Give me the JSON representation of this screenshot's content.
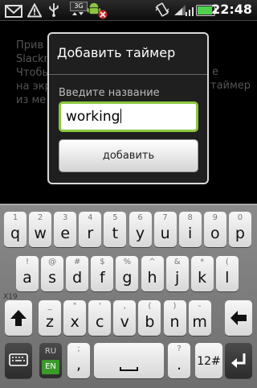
{
  "status_bar": {
    "time": "22:48",
    "network": "3G",
    "battery_level": 1.0,
    "icons": [
      "gmail-icon",
      "alert-icon",
      "usb-icon",
      "signal-3g-icon",
      "android-debug-icon",
      "sd-card-icon",
      "vibrate-icon",
      "wifi-icon",
      "signal-icon",
      "battery-icon"
    ]
  },
  "background": {
    "lines": [
      "Прив",
      "Slackn",
      "Чтобы",
      "на экр",
      "из ме"
    ],
    "right_fragments": [
      "е",
      "таймер"
    ]
  },
  "dialog": {
    "title": "Добавить таймер",
    "input_label": "Введите название",
    "input_value": "working",
    "add_button": "добавить"
  },
  "keyboard": {
    "row1": [
      {
        "sym": "1",
        "ch": "q"
      },
      {
        "sym": "2",
        "ch": "w"
      },
      {
        "sym": "3",
        "ch": "e"
      },
      {
        "sym": "4",
        "ch": "r"
      },
      {
        "sym": "5",
        "ch": "t"
      },
      {
        "sym": "6",
        "ch": "y"
      },
      {
        "sym": "7",
        "ch": "u"
      },
      {
        "sym": "8",
        "ch": "i"
      },
      {
        "sym": "9",
        "ch": "o"
      },
      {
        "sym": "0",
        "ch": "p"
      }
    ],
    "row2": [
      {
        "sym": "!",
        "ch": "a"
      },
      {
        "sym": "@",
        "ch": "s"
      },
      {
        "sym": "#",
        "ch": "d"
      },
      {
        "sym": "$",
        "ch": "f"
      },
      {
        "sym": "%",
        "ch": "g"
      },
      {
        "sym": "^",
        "ch": "h"
      },
      {
        "sym": "&",
        "ch": "j"
      },
      {
        "sym": "*",
        "ch": "k"
      },
      {
        "sym": "(",
        "ch": "l"
      }
    ],
    "row3": [
      {
        "sym": "_",
        "ch": "z"
      },
      {
        "sym": "\"",
        "ch": "x"
      },
      {
        "sym": "'",
        "ch": "c"
      },
      {
        "sym": ",",
        "ch": "v"
      },
      {
        "sym": "(",
        "ch": "b"
      },
      {
        "sym": ")",
        "ch": "n"
      },
      {
        "sym": "-",
        "ch": "m"
      }
    ],
    "row4": {
      "lang_ru": "RU",
      "lang_en": "EN",
      "semicolon_sym": ";",
      "comma": ",",
      "question_sym": "?",
      "period": ".",
      "num_key": "12#"
    },
    "x19": "X19"
  }
}
